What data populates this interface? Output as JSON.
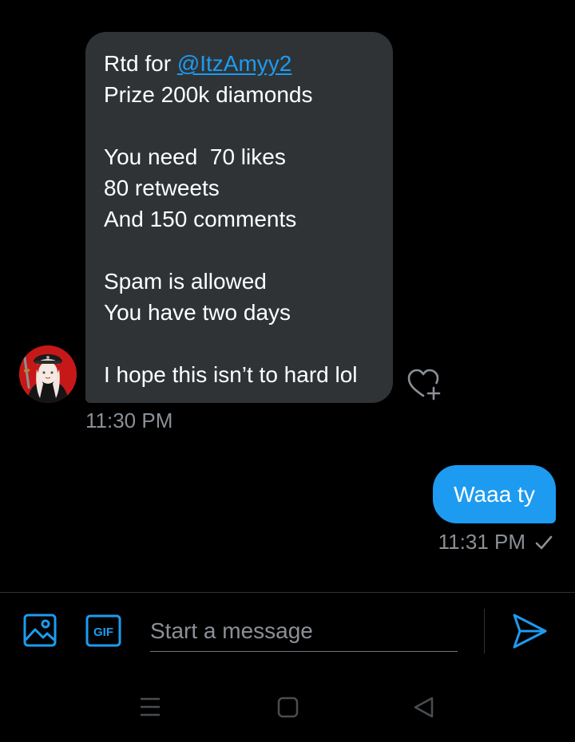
{
  "conversation": {
    "incoming": {
      "mention": "@ItzAmyy2",
      "lines": [
        "Rtd for ",
        "Prize 200k diamonds",
        "",
        "You need  70 likes",
        "80 retweets",
        "And 150 comments",
        "",
        "Spam is allowed",
        "You have two days",
        "",
        "I hope this isn’t to hard lol"
      ],
      "time": "11:30 PM",
      "avatar_icon": "profile-avatar"
    },
    "outgoing": {
      "text": "Waaa ty",
      "time": "11:31 PM",
      "status_icon": "checkmark-icon"
    }
  },
  "composer": {
    "placeholder": "Start a message",
    "gif_label": "GIF",
    "icons": [
      "image-icon",
      "gif-icon",
      "send-icon"
    ]
  },
  "navbar": {
    "icons": [
      "menu-icon",
      "home-icon",
      "back-icon"
    ]
  },
  "colors": {
    "background": "#000000",
    "bubble_incoming": "#2f3336",
    "bubble_outgoing": "#1d9bf0",
    "accent": "#1d9bf0",
    "muted_text": "#8b9096"
  }
}
